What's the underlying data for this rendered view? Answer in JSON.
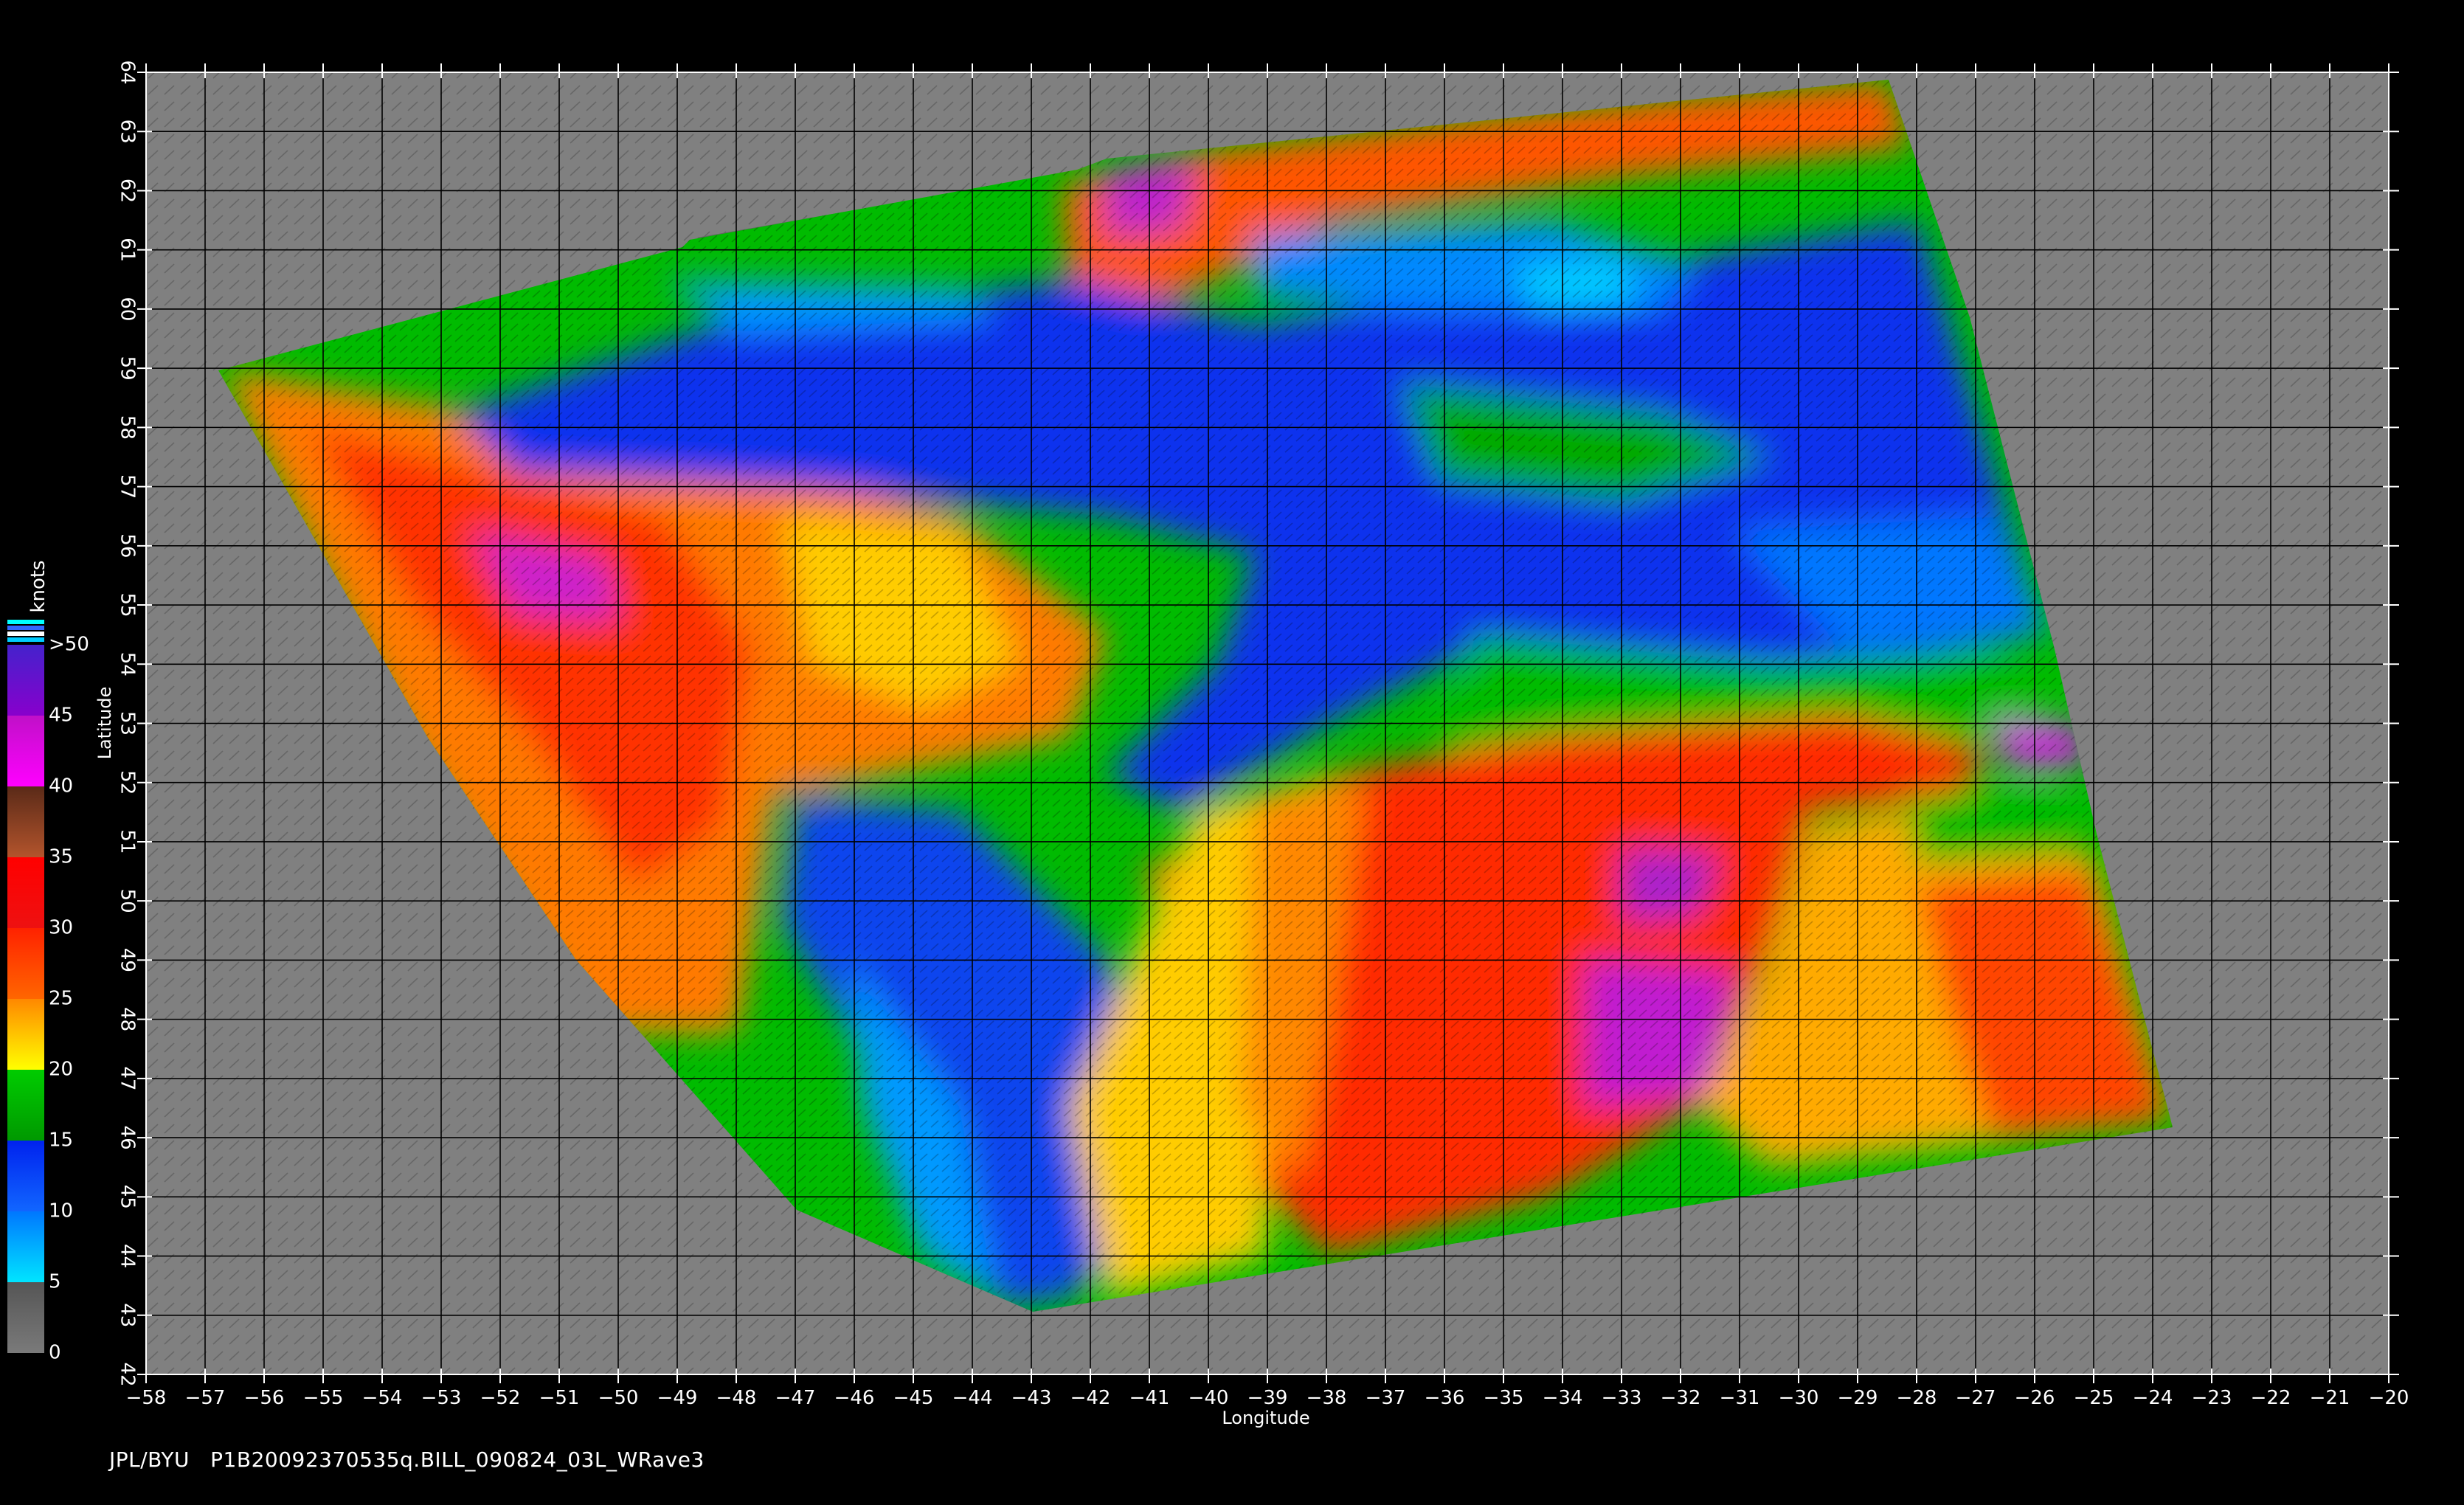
{
  "footer": {
    "credit": "JPL/BYU",
    "filename": "P1B20092370535q.BILL_090824_03L_WRave3"
  },
  "axes": {
    "x_label": "Longitude",
    "y_label": "Latitude",
    "lon_ticks": [
      -58,
      -57,
      -56,
      -55,
      -54,
      -53,
      -52,
      -51,
      -50,
      -49,
      -48,
      -47,
      -46,
      -45,
      -44,
      -43,
      -42,
      -41,
      -40,
      -39,
      -38,
      -37,
      -36,
      -35,
      -34,
      -33,
      -32,
      -31,
      -30,
      -29,
      -28,
      -27,
      -26,
      -25,
      -24,
      -23,
      -22,
      -21,
      -20
    ],
    "lat_ticks": [
      42,
      43,
      44,
      45,
      46,
      47,
      48,
      49,
      50,
      51,
      52,
      53,
      54,
      55,
      56,
      57,
      58,
      59,
      60,
      61,
      62,
      63,
      64
    ],
    "lon_range": [
      -58,
      -20
    ],
    "lat_range": [
      42,
      64
    ]
  },
  "colorbar": {
    "unit": "knots",
    "labels": [
      ">50",
      "45",
      "40",
      "35",
      "30",
      "25",
      "20",
      "15",
      "10",
      "5",
      "0"
    ],
    "bands": [
      {
        "from": 0,
        "to": 5,
        "top": "#555555",
        "bottom": "#7a7a7a"
      },
      {
        "from": 5,
        "to": 10,
        "top": "#0077ff",
        "bottom": "#00e5ff"
      },
      {
        "from": 10,
        "to": 15,
        "top": "#0022ee",
        "bottom": "#1166ff"
      },
      {
        "from": 15,
        "to": 20,
        "top": "#00cc00",
        "bottom": "#009900"
      },
      {
        "from": 20,
        "to": 25,
        "top": "#ff8800",
        "bottom": "#ffff00"
      },
      {
        "from": 25,
        "to": 30,
        "top": "#ff2200",
        "bottom": "#ff6600"
      },
      {
        "from": 30,
        "to": 35,
        "top": "#ff0000",
        "bottom": "#ee1111"
      },
      {
        "from": 35,
        "to": 40,
        "top": "#5a2a18",
        "bottom": "#b3542c"
      },
      {
        "from": 40,
        "to": 45,
        "top": "#c010c8",
        "bottom": "#ff00ff"
      },
      {
        "from": 45,
        "to": 50,
        "top": "#4422cc",
        "bottom": "#8800cc"
      }
    ]
  },
  "colors": {
    "background": "#000000",
    "land_ocean_nodata": "#808080",
    "grid": "#000000"
  }
}
